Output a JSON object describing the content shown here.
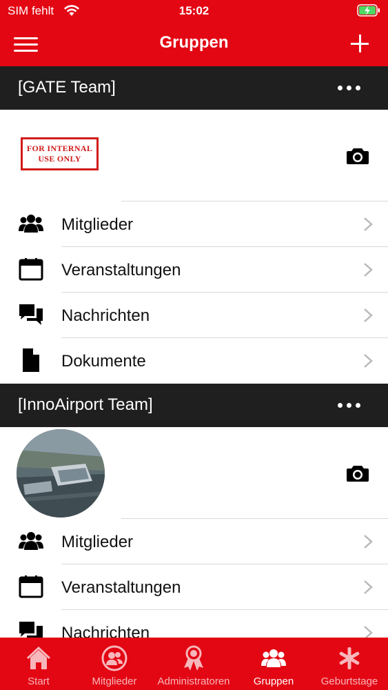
{
  "status_bar": {
    "carrier": "SIM fehlt",
    "time": "15:02"
  },
  "header": {
    "title": "Gruppen",
    "menu_icon": "hamburger-icon",
    "add_icon": "plus-icon"
  },
  "groups": [
    {
      "name": "[GATE Team]",
      "image_stamp": [
        "FOR INTERNAL",
        "USE ONLY"
      ],
      "menu": [
        {
          "label": "Mitglieder",
          "icon": "members-icon"
        },
        {
          "label": "Veranstaltungen",
          "icon": "calendar-icon"
        },
        {
          "label": "Nachrichten",
          "icon": "chat-icon"
        },
        {
          "label": "Dokumente",
          "icon": "document-icon"
        }
      ]
    },
    {
      "name": "[InnoAirport Team]",
      "menu": [
        {
          "label": "Mitglieder",
          "icon": "members-icon"
        },
        {
          "label": "Veranstaltungen",
          "icon": "calendar-icon"
        },
        {
          "label": "Nachrichten",
          "icon": "chat-icon"
        }
      ]
    }
  ],
  "tabbar": {
    "tabs": [
      {
        "label": "Start",
        "icon": "home-icon",
        "active": false
      },
      {
        "label": "Mitglieder",
        "icon": "member-circle-icon",
        "active": false
      },
      {
        "label": "Administratoren",
        "icon": "award-icon",
        "active": false
      },
      {
        "label": "Gruppen",
        "icon": "group-icon",
        "active": true
      },
      {
        "label": "Geburtstage",
        "icon": "asterisk-icon",
        "active": false
      }
    ]
  },
  "colors": {
    "brand_red": "#e30613",
    "group_bar": "#1f1f1f",
    "inactive_tab": "#f7b7bb"
  }
}
